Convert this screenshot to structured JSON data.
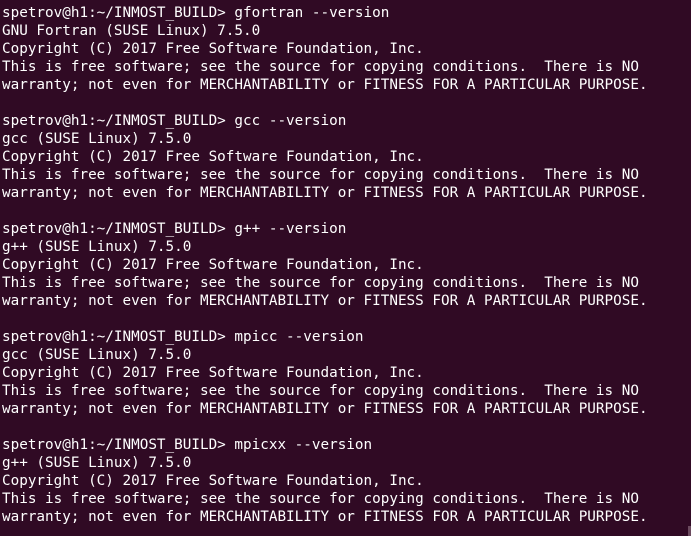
{
  "terminal": {
    "blocks": [
      {
        "prompt": "spetrov@h1:~/INMOST_BUILD> gfortran --version",
        "lines": [
          "GNU Fortran (SUSE Linux) 7.5.0",
          "Copyright (C) 2017 Free Software Foundation, Inc.",
          "This is free software; see the source for copying conditions.  There is NO",
          "warranty; not even for MERCHANTABILITY or FITNESS FOR A PARTICULAR PURPOSE."
        ]
      },
      {
        "prompt": "spetrov@h1:~/INMOST_BUILD> gcc --version",
        "lines": [
          "gcc (SUSE Linux) 7.5.0",
          "Copyright (C) 2017 Free Software Foundation, Inc.",
          "This is free software; see the source for copying conditions.  There is NO",
          "warranty; not even for MERCHANTABILITY or FITNESS FOR A PARTICULAR PURPOSE."
        ]
      },
      {
        "prompt": "spetrov@h1:~/INMOST_BUILD> g++ --version",
        "lines": [
          "g++ (SUSE Linux) 7.5.0",
          "Copyright (C) 2017 Free Software Foundation, Inc.",
          "This is free software; see the source for copying conditions.  There is NO",
          "warranty; not even for MERCHANTABILITY or FITNESS FOR A PARTICULAR PURPOSE."
        ]
      },
      {
        "prompt": "spetrov@h1:~/INMOST_BUILD> mpicc --version",
        "lines": [
          "gcc (SUSE Linux) 7.5.0",
          "Copyright (C) 2017 Free Software Foundation, Inc.",
          "This is free software; see the source for copying conditions.  There is NO",
          "warranty; not even for MERCHANTABILITY or FITNESS FOR A PARTICULAR PURPOSE."
        ]
      },
      {
        "prompt": "spetrov@h1:~/INMOST_BUILD> mpicxx --version",
        "lines": [
          "g++ (SUSE Linux) 7.5.0",
          "Copyright (C) 2017 Free Software Foundation, Inc.",
          "This is free software; see the source for copying conditions.  There is NO",
          "warranty; not even for MERCHANTABILITY or FITNESS FOR A PARTICULAR PURPOSE."
        ]
      }
    ],
    "colors": {
      "background": "#300a24",
      "foreground": "#ffffff"
    }
  }
}
